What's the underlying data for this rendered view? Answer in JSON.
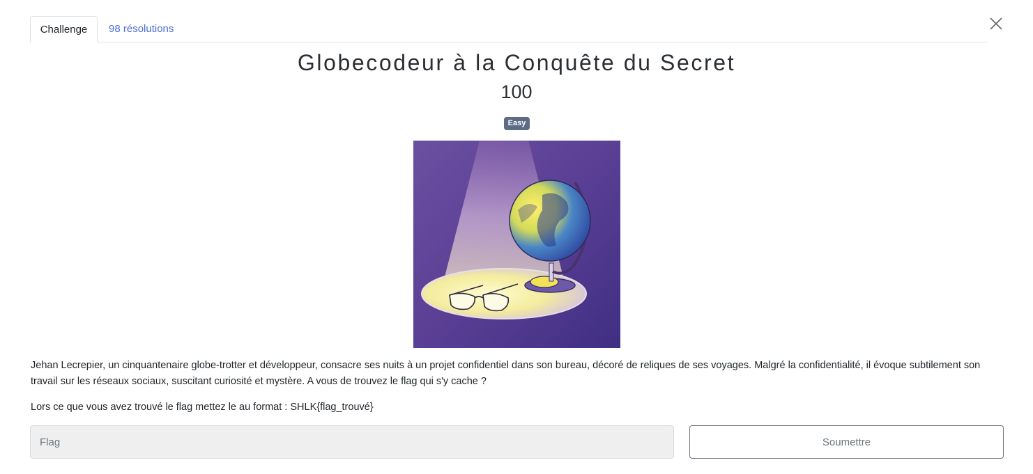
{
  "tabs": {
    "challenge": "Challenge",
    "solves": "98 résolutions"
  },
  "challenge": {
    "name": "Globecodeur à la Conquête du Secret",
    "points": "100",
    "difficulty": "Easy",
    "description": "Jehan Lecrepier, un cinquantenaire globe-trotter et développeur, consacre ses nuits à un projet confidentiel dans son bureau, décoré de reliques de ses voyages. Malgré la confidentialité, il évoque subtilement son travail sur les réseaux sociaux, suscitant curiosité et mystère. A vous de trouvez le flag qui s'y cache ?",
    "format_hint": "Lors ce que vous avez trouvé le flag mettez le au format : SHLK{flag_trouvé}"
  },
  "form": {
    "flag_placeholder": "Flag",
    "flag_value": "",
    "submit_label": "Soumettre"
  },
  "icons": {
    "close": "close-icon"
  },
  "colors": {
    "link": "#4b6fd3",
    "badge": "#5e6b85",
    "input_bg": "#efefef"
  }
}
